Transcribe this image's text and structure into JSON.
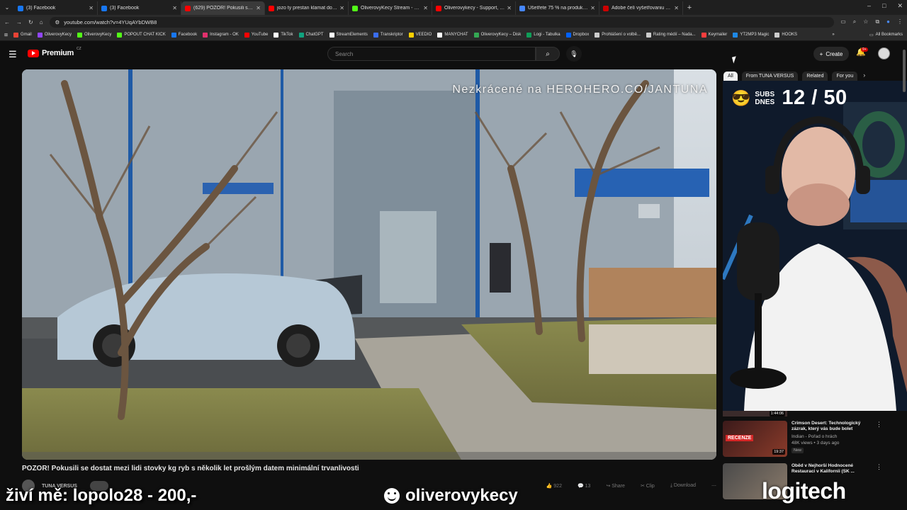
{
  "browser": {
    "tabs": [
      {
        "label": "(3) Facebook",
        "color": "#1877f2",
        "active": false
      },
      {
        "label": "(3) Facebook",
        "color": "#1877f2",
        "active": false
      },
      {
        "label": "(629) POZOR! Pokusili se d...",
        "color": "#ff0000",
        "active": true
      },
      {
        "label": "jozo ty prestan klamat do telky",
        "color": "#ff0000",
        "active": false
      },
      {
        "label": "OliverovyKecy Stream - Watch L...",
        "color": "#53fc18",
        "active": false
      },
      {
        "label": "Oliverovykecy - Support, Tips &...",
        "color": "#ff0000",
        "active": false
      },
      {
        "label": "Ušetřete 75 % na produktu Nor...",
        "color": "#4687ff",
        "active": false
      },
      {
        "label": "Adobe čelí vyšetřovaniu v Britá...",
        "color": "#cc0000",
        "active": false
      }
    ],
    "url": "youtube.com/watch?v=4YUqAYbDWB8",
    "bookmarks": [
      {
        "label": "Gmail",
        "color": "#ea4335"
      },
      {
        "label": "OliverovyKecy",
        "color": "#9146ff"
      },
      {
        "label": "OliverovyKecy",
        "color": "#53fc18"
      },
      {
        "label": "POPOUT CHAT KICK",
        "color": "#53fc18"
      },
      {
        "label": "Facebook",
        "color": "#1877f2"
      },
      {
        "label": "Instagram - OK",
        "color": "#e1306c"
      },
      {
        "label": "YouTube",
        "color": "#ff0000"
      },
      {
        "label": "TikTok",
        "color": "#ffffff"
      },
      {
        "label": "ChatGPT",
        "color": "#10a37f"
      },
      {
        "label": "StreamElements",
        "color": "#ffffff"
      },
      {
        "label": "Transkriptor",
        "color": "#3a6df0"
      },
      {
        "label": "VEEDIO",
        "color": "#ffd000"
      },
      {
        "label": "MANYCHAT",
        "color": "#ffffff"
      },
      {
        "label": "OliverovyKecy – Disk",
        "color": "#34a853"
      },
      {
        "label": "Logi - Tabulka",
        "color": "#0f9d58"
      },
      {
        "label": "Dropbox",
        "color": "#0061ff"
      },
      {
        "label": "Prohlášení o volbě...",
        "color": "#cccccc"
      },
      {
        "label": "Rating médií – Nada...",
        "color": "#cccccc"
      },
      {
        "label": "Keymailer",
        "color": "#ff3d3d"
      },
      {
        "label": "YT2MP3 Magic",
        "color": "#1e88e5"
      },
      {
        "label": "HOOKS",
        "color": "#cccccc"
      }
    ],
    "all_bookmarks": "All Bookmarks"
  },
  "youtube": {
    "logo_text": "Premium",
    "logo_region": "CZ",
    "search_placeholder": "Search",
    "create_label": "Create",
    "notif_badge": "9+"
  },
  "video": {
    "overlay": "Nezkrácené na HEROHERO.CO/JANTUNA",
    "title": "POZOR! Pokusili se dostat mezi lidi stovky kg ryb s několik let prošlým datem minimální trvanlivosti",
    "channel": "TUNA VERSUS",
    "likes": "922",
    "comments": "13",
    "share": "Share",
    "clip": "Clip",
    "download": "Download"
  },
  "chips": [
    "All",
    "From TUNA VERSUS",
    "Related",
    "For you"
  ],
  "webcam": {
    "subs_label": "SUBS DNES",
    "subs_count": "12 / 50"
  },
  "recommendations": [
    {
      "title": "Crimson Desert: Technologický zázrak, který vás bude bolet",
      "channel": "Indian - Pořad o hrách",
      "views": "48K views • 3 days ago",
      "badge": "New",
      "duration": "19:37",
      "thumb_text": "RECENZE",
      "prev_duration": "1:44:06"
    },
    {
      "title": "Oběd v Nejhorší Hodnocené Restauraci v Kalifornii (SK ...",
      "channel": "",
      "views": "",
      "badge": "",
      "duration": "",
      "thumb_text": ""
    }
  ],
  "stream_overlay": {
    "left": "živí mě: lopolo28 - 200,-",
    "middle": "oliverovykecy",
    "right": "logitech"
  }
}
